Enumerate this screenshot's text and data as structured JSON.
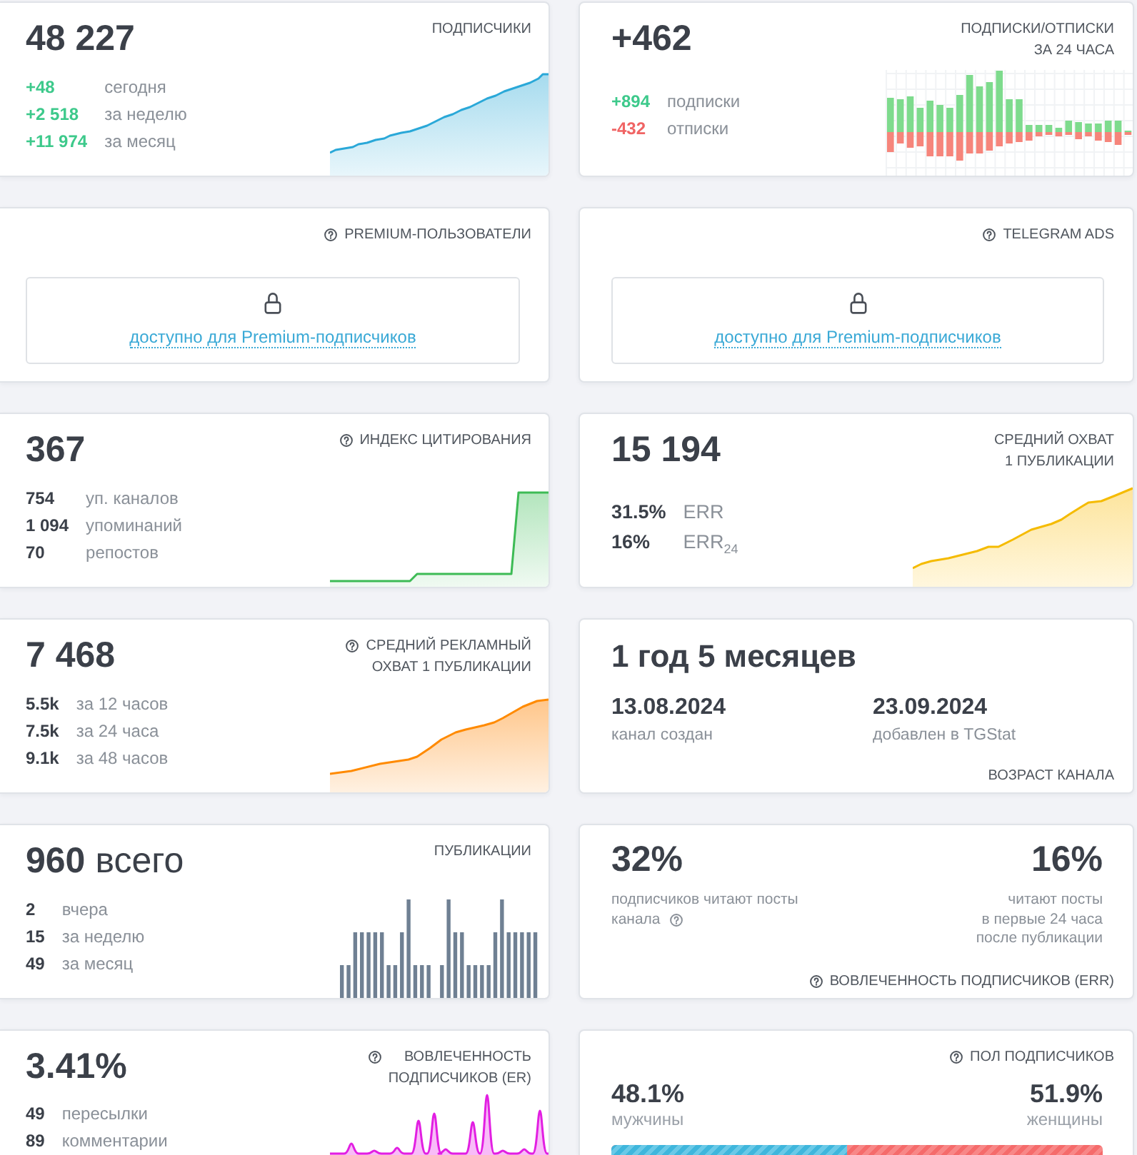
{
  "cards": [
    {
      "kind": "metric",
      "title": "ПОДПИСЧИКИ",
      "help": false,
      "value": "48 227",
      "stats": [
        {
          "kind": "gain",
          "value": "+48",
          "label": "сегодня"
        },
        {
          "kind": "gain",
          "value": "+2 518",
          "label": "за неделю"
        },
        {
          "kind": "gain",
          "value": "+11 974",
          "label": "за месяц"
        }
      ]
    },
    {
      "kind": "metric",
      "title": "ПОДПИСКИ/ОТПИСКИ\nЗА 24 ЧАСА",
      "help": false,
      "value": "+462",
      "stats": [
        {
          "kind": "gain",
          "value": "+894",
          "label": "подписки"
        },
        {
          "kind": "loss",
          "value": "-432",
          "label": "отписки"
        }
      ]
    },
    {
      "kind": "locked",
      "title": "PREMIUM-ПОЛЬЗОВАТЕЛИ",
      "help": true,
      "link": "доступно для Premium-подписчиков"
    },
    {
      "kind": "locked",
      "title": "TELEGRAM ADS",
      "help": true,
      "link": "доступно для Premium-подписчиков"
    },
    {
      "kind": "metric",
      "title": "ИНДЕКС ЦИТИРОВАНИЯ",
      "help": true,
      "value": "367",
      "stats": [
        {
          "kind": "count",
          "value": "754",
          "label": "уп. каналов"
        },
        {
          "kind": "count",
          "value": "1 094",
          "label": "упоминаний"
        },
        {
          "kind": "count",
          "value": "70",
          "label": "репостов"
        }
      ]
    },
    {
      "kind": "metric",
      "title": "СРЕДНИЙ ОХВАТ\n1 ПУБЛИКАЦИИ",
      "help": false,
      "value": "15 194",
      "stats": [
        {
          "kind": "ratio",
          "value": "31.5%",
          "label": "ERR"
        },
        {
          "kind": "ratio",
          "value": "16%",
          "label": "ERR$_{24}$"
        }
      ]
    },
    {
      "kind": "metric",
      "title": "СРЕДНИЙ РЕКЛАМНЫЙ\nОХВАТ 1 ПУБЛИКАЦИИ",
      "help": true,
      "value": "7 468",
      "stats": [
        {
          "kind": "count",
          "value": "5.5k",
          "label": "за 12 часов"
        },
        {
          "kind": "count",
          "value": "7.5k",
          "label": "за 24 часа"
        },
        {
          "kind": "count",
          "value": "9.1k",
          "label": "за 48 часов"
        }
      ]
    },
    {
      "kind": "age",
      "title": "ВОЗРАСТ КАНАЛА",
      "help": false,
      "value": "1 год 5 месяцев",
      "dates": [
        {
          "value": "13.08.2024",
          "label": "канал создан"
        },
        {
          "value": "23.09.2024",
          "label": "добавлен в TGStat"
        }
      ]
    },
    {
      "kind": "metric",
      "title": "ПУБЛИКАЦИИ",
      "help": false,
      "value": "960",
      "unit": "всего",
      "stats": [
        {
          "kind": "count",
          "value": "2",
          "label": "вчера"
        },
        {
          "kind": "count",
          "value": "15",
          "label": "за неделю"
        },
        {
          "kind": "count",
          "value": "49",
          "label": "за месяц"
        }
      ]
    },
    {
      "kind": "engagement",
      "title": "ВОВЛЕЧЕННОСТЬ ПОДПИСЧИКОВ (ERR)",
      "help": true,
      "parts": [
        {
          "value": "32%",
          "note": [
            "подписчиков читают посты",
            "канала"
          ],
          "help": true
        },
        {
          "value": "16%",
          "note": [
            "читают посты",
            "в первые 24 часа",
            "после публикации"
          ],
          "help": false
        }
      ]
    },
    {
      "kind": "metric",
      "title": "ВОВЛЕЧЕННОСТЬ\nПОДПИСЧИКОВ (ER)",
      "help": true,
      "value": "3.41%",
      "stats": [
        {
          "kind": "count",
          "value": "49",
          "label": "пересылки"
        },
        {
          "kind": "count",
          "value": "89",
          "label": "комментарии"
        }
      ]
    },
    {
      "kind": "gender",
      "title": "ПОЛ ПОДПИСЧИКОВ",
      "help": true,
      "level": 0.481,
      "groups": [
        {
          "value": "48.1%",
          "label": "мужчины"
        },
        {
          "value": "51.9%",
          "label": "женщины"
        }
      ]
    }
  ]
}
